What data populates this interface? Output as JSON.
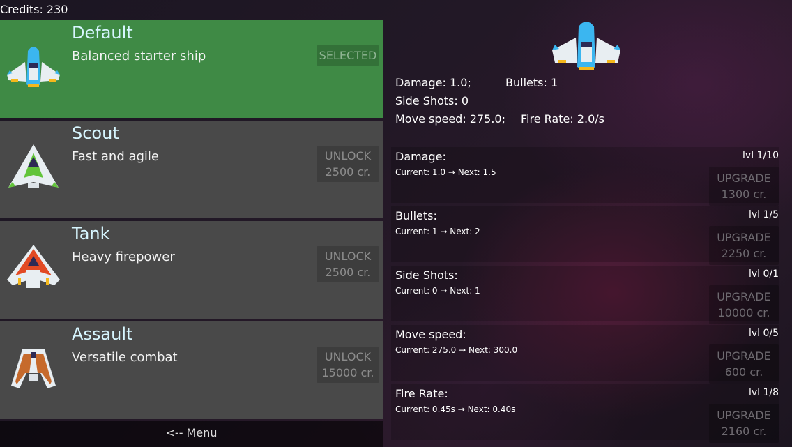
{
  "credits": "Credits: 230",
  "ships": [
    {
      "name": "Default",
      "desc": "Balanced starter ship",
      "button": "SELECTED",
      "button2": "",
      "icon": "default-ship-icon",
      "selected": true
    },
    {
      "name": "Scout",
      "desc": "Fast and agile",
      "button": "UNLOCK",
      "button2": "2500 cr.",
      "icon": "scout-ship-icon",
      "selected": false
    },
    {
      "name": "Tank",
      "desc": "Heavy firepower",
      "button": "UNLOCK",
      "button2": "2500 cr.",
      "icon": "tank-ship-icon",
      "selected": false
    },
    {
      "name": "Assault",
      "desc": "Versatile combat",
      "button": "UNLOCK",
      "button2": "15000 cr.",
      "icon": "assault-ship-icon",
      "selected": false
    }
  ],
  "menu": "<-- Menu",
  "stats": {
    "damage": "Damage: 1.0;",
    "bullets": "Bullets: 1",
    "side_shots": "Side Shots: 0",
    "move_speed": "Move speed: 275.0;",
    "fire_rate": "Fire Rate: 2.0/s"
  },
  "upgrades": [
    {
      "name": "Damage:",
      "level": "lvl 1/10",
      "current": "Current: 1.0 → Next: 1.5",
      "button": "UPGRADE",
      "cost": "1300 cr."
    },
    {
      "name": "Bullets:",
      "level": "lvl 1/5",
      "current": "Current: 1 → Next: 2",
      "button": "UPGRADE",
      "cost": "2250 cr."
    },
    {
      "name": "Side Shots:",
      "level": "lvl 0/1",
      "current": "Current: 0 → Next: 1",
      "button": "UPGRADE",
      "cost": "10000 cr."
    },
    {
      "name": "Move speed:",
      "level": "lvl 0/5",
      "current": "Current: 275.0 → Next: 300.0",
      "button": "UPGRADE",
      "cost": "600 cr."
    },
    {
      "name": "Fire Rate:",
      "level": "lvl 1/8",
      "current": "Current: 0.45s → Next: 0.40s",
      "button": "UPGRADE",
      "cost": "2160 cr."
    }
  ],
  "colors": {
    "selected_card": "#3f8a45",
    "card": "#494949",
    "name_text": "#d7f6ff"
  }
}
